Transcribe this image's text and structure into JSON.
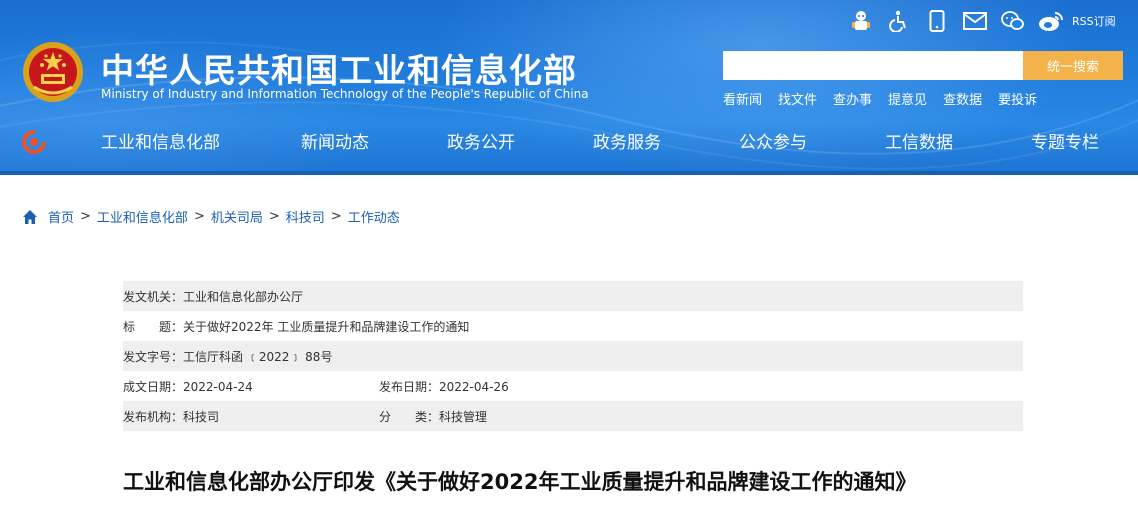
{
  "header": {
    "title_cn": "中华人民共和国工业和信息化部",
    "title_en": "Ministry of Industry and Information Technology of the People's Republic of China",
    "top_icons": [
      "robot-icon",
      "accessibility-icon",
      "mobile-icon",
      "mail-icon",
      "wechat-icon",
      "weibo-icon",
      "rss-icon"
    ],
    "rss_label": "RSS订阅",
    "search": {
      "placeholder": "",
      "button_label": "统一搜索"
    },
    "quick_links": [
      "看新闻",
      "找文件",
      "查办事",
      "提意见",
      "查数据",
      "要投诉"
    ]
  },
  "nav": {
    "items": [
      "工业和信息化部",
      "新闻动态",
      "政务公开",
      "政务服务",
      "公众参与",
      "工信数据",
      "专题专栏"
    ]
  },
  "breadcrumb": [
    "首页",
    "工业和信息化部",
    "机关司局",
    "科技司",
    "工作动态"
  ],
  "meta": {
    "issuer": "发文机关：工业和信息化部办公厅",
    "subject": "标　　题：关于做好2022年 工业质量提升和品牌建设工作的通知",
    "doc_number": "发文字号：工信厅科函 ﹝2022﹞ 88号",
    "date_written": "成文日期：2022-04-24",
    "date_published": "发布日期：2022-04-26",
    "org": "发布机构：科技司",
    "category": "分　　类：科技管理"
  },
  "article": {
    "title": "工业和信息化部办公厅印发《关于做好2022年工业质量提升和品牌建设工作的通知》"
  },
  "colors": {
    "header_blue": "#1f7bdb",
    "search_button": "#f4b24a",
    "link_blue": "#1a5fb4"
  }
}
